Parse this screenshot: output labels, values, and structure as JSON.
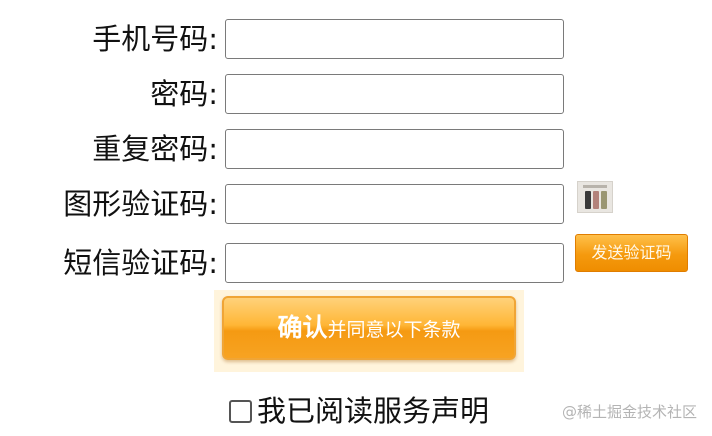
{
  "form": {
    "phone_label": "手机号码:",
    "password_label": "密码:",
    "confirm_password_label": "重复密码:",
    "captcha_label": "图形验证码:",
    "sms_code_label": "短信验证码:",
    "phone_value": "",
    "password_value": "",
    "confirm_password_value": "",
    "captcha_value": "",
    "sms_code_value": ""
  },
  "buttons": {
    "send_sms_label": "发送验证码",
    "confirm_strong": "确认",
    "confirm_rest": "并同意以下条款"
  },
  "agreement": {
    "text": "我已阅读服务声明",
    "checked": false
  },
  "watermark": "@稀土掘金技术社区",
  "colors": {
    "button_orange": "#f59a0e",
    "captcha_swatches": [
      "#3a3a3a",
      "#b3827a",
      "#9a9672"
    ]
  }
}
